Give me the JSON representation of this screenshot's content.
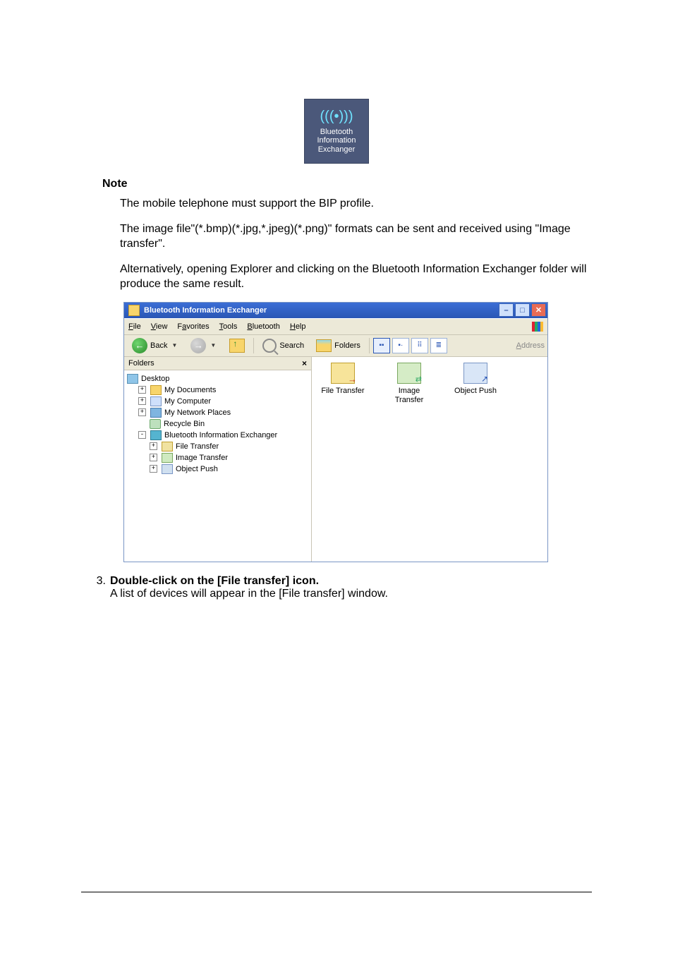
{
  "desktop_icon": {
    "signal_glyph": "(((•)))",
    "line1": "Bluetooth",
    "line2": "Information",
    "line3": "Exchanger"
  },
  "note_heading": "Note",
  "note_p1": "The mobile telephone must support the BIP profile.",
  "note_p2": "The image file\"(*.bmp)(*.jpg,*.jpeg)(*.png)\" formats can be sent and received using \"Image transfer\".",
  "note_p3": "Alternatively, opening Explorer and clicking on the Bluetooth Information Exchanger folder will produce the same result.",
  "window": {
    "title": "Bluetooth Information Exchanger",
    "menu": [
      "File",
      "View",
      "Favorites",
      "Tools",
      "Bluetooth",
      "Help"
    ],
    "back_label": "Back",
    "search_label": "Search",
    "folders_label": "Folders",
    "address_label": "Address",
    "folders_title": "Folders",
    "tree": {
      "desktop": "Desktop",
      "docs": "My Documents",
      "computer": "My Computer",
      "net": "My Network Places",
      "bin": "Recycle Bin",
      "bt": "Bluetooth Information Exchanger",
      "ft": "File Transfer",
      "it": "Image Transfer",
      "op": "Object Push"
    },
    "items": {
      "ft": "File Transfer",
      "it": "Image Transfer",
      "op": "Object Push"
    }
  },
  "step": {
    "num": "3.",
    "heading": "Double-click on the [File transfer] icon.",
    "body": "A list of devices will appear in the [File transfer] window."
  }
}
